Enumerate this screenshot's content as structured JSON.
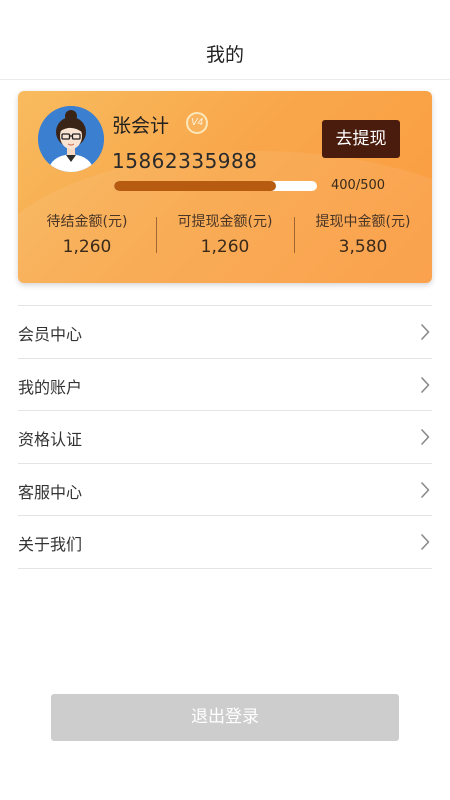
{
  "header": {
    "title": "我的"
  },
  "profile": {
    "name": "张会计",
    "vip_badge": "V4",
    "phone": "15862335988",
    "withdraw_label": "去提现",
    "progress_text": "400/500",
    "progress_fraction": 0.8,
    "stats": [
      {
        "label": "待结金额(元)",
        "value": "1,260"
      },
      {
        "label": "可提现金额(元)",
        "value": "1,260"
      },
      {
        "label": "提现中金额(元)",
        "value": "3,580"
      }
    ]
  },
  "menu": {
    "items": [
      {
        "label": "会员中心",
        "icon": "chevron-right-icon"
      },
      {
        "label": "我的账户",
        "icon": "chevron-right-icon"
      },
      {
        "label": "资格认证",
        "icon": "chevron-right-icon"
      },
      {
        "label": "客服中心",
        "icon": "chevron-right-icon"
      },
      {
        "label": "关于我们",
        "icon": "chevron-right-icon"
      }
    ]
  },
  "logout": {
    "label": "退出登录"
  },
  "colors": {
    "card_gradient_start": "#f8bb5e",
    "card_gradient_end": "#fa9b40",
    "withdraw_button": "#4a1c0d",
    "progress_fill": "#b75b10",
    "logout_button": "#cdcdcd"
  }
}
